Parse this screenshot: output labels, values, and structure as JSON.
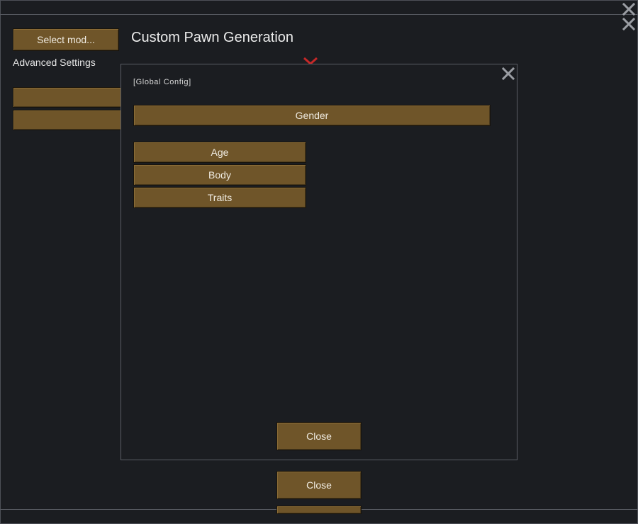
{
  "background_window": {
    "select_mod_button": "Select mod...",
    "title": "Custom Pawn Generation",
    "advanced_settings_label": "Advanced Settings",
    "close_button": "Close",
    "close_icon_top": "close-icon",
    "close_icon_second": "close-icon",
    "red_marker_icon": "red-x-icon"
  },
  "dialog": {
    "header_label": "[Global Config]",
    "gender_button": "Gender",
    "category_buttons": [
      "Age",
      "Body",
      "Traits"
    ],
    "close_button": "Close",
    "close_icon": "close-icon"
  },
  "colors": {
    "background": "#1b1d21",
    "button_fill": "#6f5529",
    "frame_border": "#5b5e65",
    "close_x": "#9a9da3",
    "red_marker": "#c62828"
  }
}
